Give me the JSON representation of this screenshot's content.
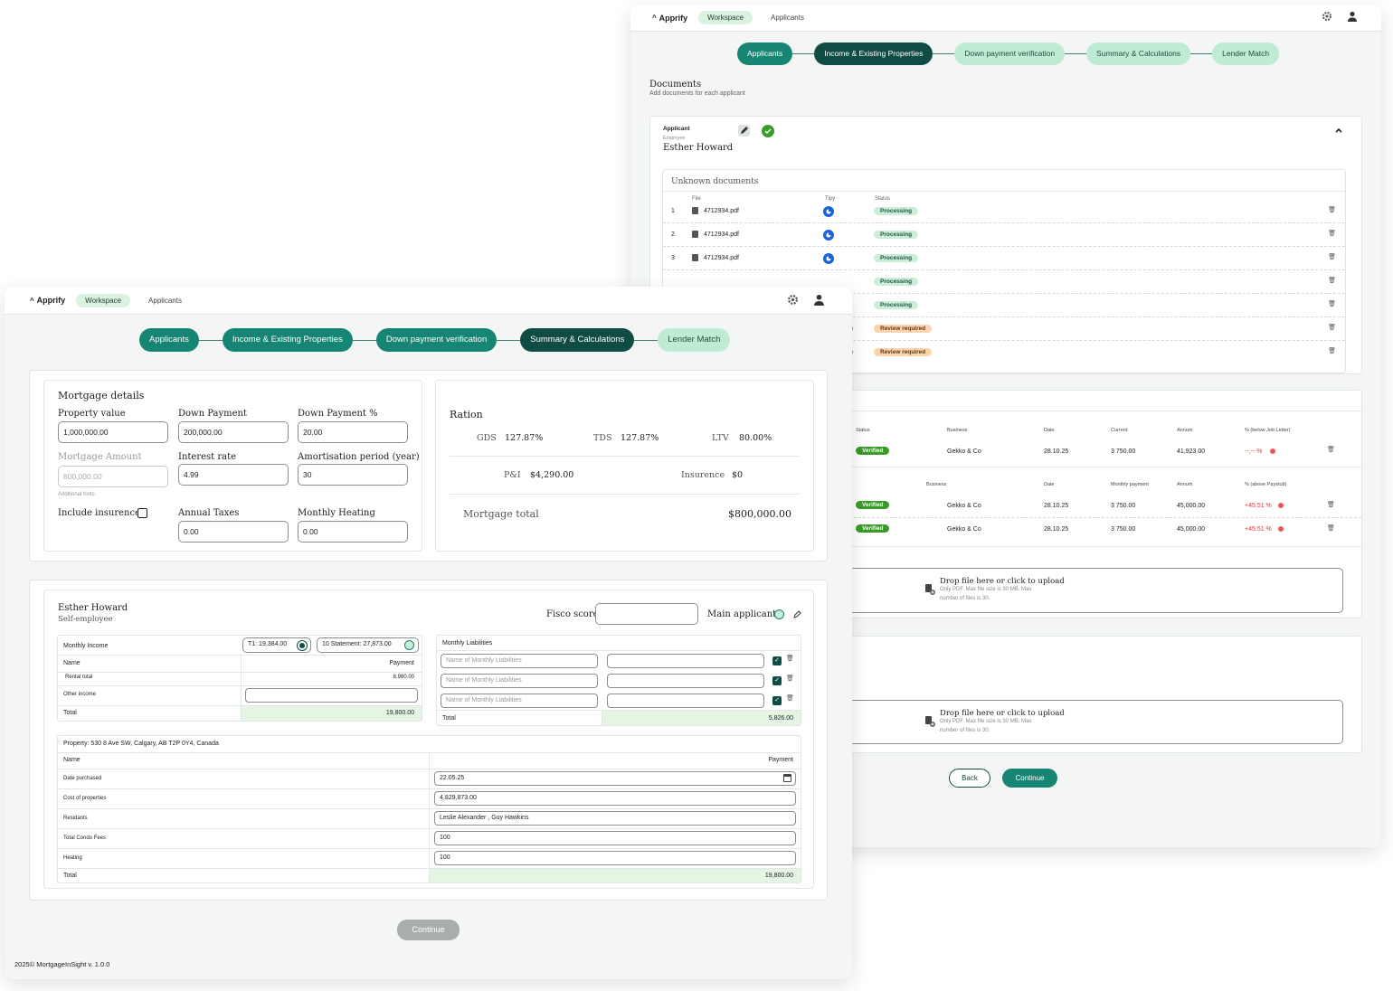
{
  "app": {
    "logo": "Apprify",
    "nav_workspace": "Workspace",
    "nav_applicants": "Applicants"
  },
  "colors": {
    "primary": "#178573",
    "primary_dark": "#0f4c44",
    "step_inactive": "#bfead4",
    "processing": "#c9efd9",
    "review": "#fbd3ad",
    "verified": "#3a9a2a"
  },
  "back": {
    "steps": [
      "Applicants",
      "Income & Existing Properties",
      "Down payment verification",
      "Summary & Calculations",
      "Lender Match"
    ],
    "documents_title": "Documents",
    "documents_subtitle": "Add documents for each applicant",
    "applicant_label": "Applicant",
    "applicant_role": "Employee",
    "applicant_name": "Esther Howard",
    "unknown_docs": {
      "title": "Unknown documents",
      "headers": {
        "file": "File",
        "type": "Tipy",
        "status": "Status"
      },
      "rows": [
        {
          "num": "1",
          "file": "4712934.pdf",
          "status": "Processing",
          "status_type": "proc"
        },
        {
          "num": "2",
          "file": "4712934.pdf",
          "status": "Processing",
          "status_type": "proc"
        },
        {
          "num": "3",
          "file": "4712934.pdf",
          "status": "Processing",
          "status_type": "proc"
        },
        {
          "num": "",
          "file": "",
          "status": "Processing",
          "status_type": "proc"
        },
        {
          "num": "",
          "file": "",
          "status": "Processing",
          "status_type": "proc"
        },
        {
          "num": "",
          "file": "n",
          "status": "Review required",
          "status_type": "rev"
        },
        {
          "num": "",
          "file": "n",
          "status": "Review required",
          "status_type": "rev"
        }
      ]
    },
    "income_table1": {
      "headers": [
        "Status",
        "Business",
        "Date",
        "Current",
        "Annum",
        "% (below Job Letter)"
      ],
      "rows": [
        [
          "Verified",
          "Gekko & Co",
          "28.10.25",
          "3 750.00",
          "41,923.00",
          "--,-- %"
        ]
      ]
    },
    "income_table2": {
      "headers": [
        "Status",
        "Business",
        "Date",
        "Monthly payment",
        "Annum",
        "% (above Paystub)"
      ],
      "rows": [
        [
          "r",
          "Verified",
          "Gekko & Co",
          "28.10.25",
          "3 750.00",
          "45,000.00",
          "+45.51 %"
        ],
        [
          "r",
          "Verified",
          "Gekko & Co",
          "28.10.25",
          "3 750.00",
          "45,000.00",
          "+45.51 %"
        ]
      ]
    },
    "drop": {
      "title": "Drop file here or click to upload",
      "hint1": "Only PDF. Max file size is 30 MB. Max",
      "hint2": "number of files is 30."
    },
    "back_btn": "Back",
    "continue_btn": "Continue"
  },
  "front": {
    "steps": [
      "Applicants",
      "Income & Existing Properties",
      "Down payment verification",
      "Summary & Calculations",
      "Lender Match"
    ],
    "mortgage": {
      "title": "Mortgage details",
      "property_value_label": "Property value",
      "property_value": "1,000,000.00",
      "down_payment_label": "Down Payment",
      "down_payment": "200,000.00",
      "down_payment_pct_label": "Down Payment %",
      "down_payment_pct": "20.00",
      "mortgage_amount_label": "Mortgage Amount",
      "mortgage_amount": "800,000.00",
      "interest_rate_label": "Interest rate",
      "interest_rate": "4.99",
      "amortisation_label": "Amortisation period (year)",
      "amortisation": "30",
      "hint": "Additional hints",
      "include_insurance": "Include insurence",
      "annual_taxes_label": "Annual Taxes",
      "annual_taxes": "0.00",
      "monthly_heating_label": "Monthly Heating",
      "monthly_heating": "0.00"
    },
    "ration": {
      "title": "Ration",
      "gds_label": "GDS",
      "gds": "127.87%",
      "tds_label": "TDS",
      "tds": "127.87%",
      "ltv_label": "LTV",
      "ltv": "80.00%",
      "pi_label": "P&I",
      "pi": "$4,290.00",
      "ins_label": "Insurence",
      "ins": "$0",
      "total_label": "Mortgage total",
      "total": "$800,000.00"
    },
    "applicant": {
      "name": "Esther Howard",
      "role": "Self-employee",
      "fisco_label": "Fisco score",
      "main_label": "Main applicant"
    },
    "monthly_income": {
      "title": "Monthly Income",
      "t1": "T1: 19,384.00",
      "stmt": "10 Statement: 27,873.00",
      "name_h": "Name",
      "payment_h": "Payment",
      "rows": [
        {
          "name": "Rental total",
          "value": "8,980.00"
        },
        {
          "name": "Other income",
          "value": ""
        }
      ],
      "total_label": "Total",
      "total": "19,800.00"
    },
    "liabilities": {
      "title": "Monthly Liabilities",
      "placeholder": "Name of Monthly Liabilities",
      "total_label": "Total",
      "total": "5,826.00"
    },
    "property": {
      "title": "Property: 530 8 Ave SW, Calgary, AB T2P 0Y4, Canada",
      "name_h": "Name",
      "payment_h": "Payment",
      "rows": [
        {
          "name": "Date purchased",
          "value": "22.05.25"
        },
        {
          "name": "Cost of properties",
          "value": "4,829,873.00"
        },
        {
          "name": "Residants",
          "value": "Leslie Alexander , Guy Hawkins"
        },
        {
          "name": "Total Condo Fees",
          "value": "100"
        },
        {
          "name": "Heating",
          "value": "100"
        }
      ],
      "total_label": "Total",
      "total": "19,800.00"
    },
    "continue_btn": "Continue",
    "footer": "2025© MortgageInSight v. 1.0.0"
  }
}
